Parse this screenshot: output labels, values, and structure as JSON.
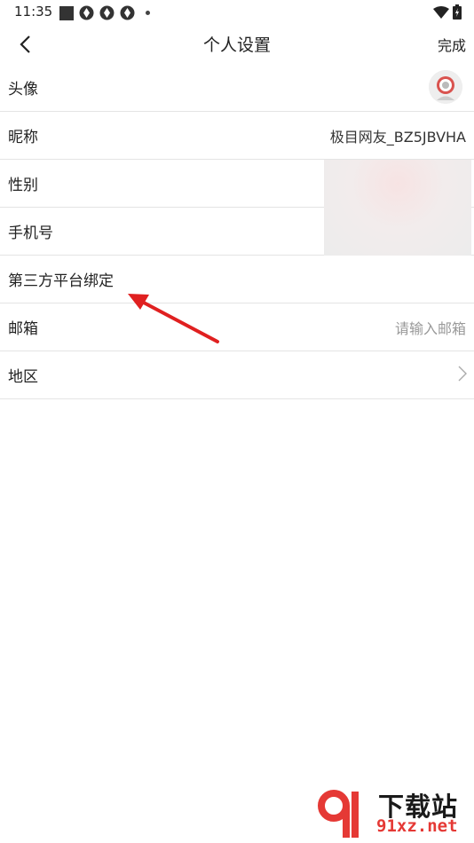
{
  "status_bar": {
    "time": "11:35"
  },
  "nav": {
    "title": "个人设置",
    "done_label": "完成"
  },
  "rows": [
    {
      "label": "头像"
    },
    {
      "label": "昵称",
      "value": "极目网友_BZ5JBVHA"
    },
    {
      "label": "性别"
    },
    {
      "label": "手机号"
    },
    {
      "label": "第三方平台绑定"
    },
    {
      "label": "邮箱",
      "placeholder": "请输入邮箱"
    },
    {
      "label": "地区"
    }
  ],
  "watermark": {
    "text": "下载站",
    "url": "91xz.net",
    "logo": "9f"
  },
  "colors": {
    "annotation_arrow": "#e02020",
    "watermark_red": "#e53935"
  }
}
